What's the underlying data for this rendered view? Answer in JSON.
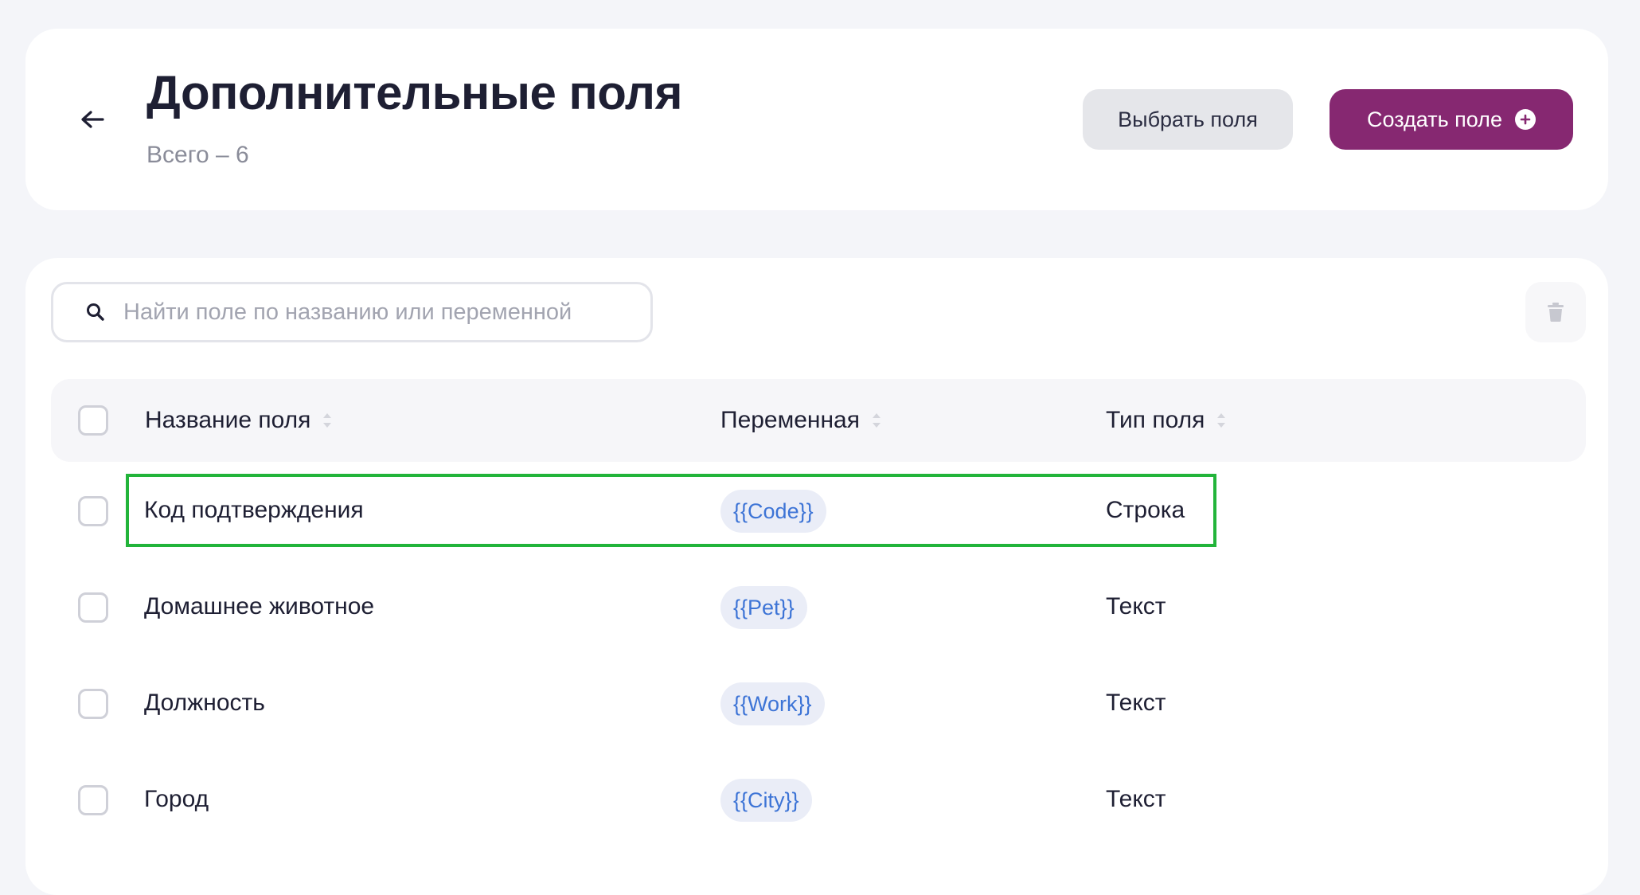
{
  "header": {
    "title": "Дополнительные поля",
    "subtitle": "Всего – 6",
    "select_fields_label": "Выбрать поля",
    "create_field_label": "Создать поле"
  },
  "search": {
    "placeholder": "Найти поле по названию или переменной",
    "value": ""
  },
  "table": {
    "columns": [
      "Название поля",
      "Переменная",
      "Тип поля"
    ],
    "rows": [
      {
        "name": "Код подтверждения",
        "variable": "{{Code}}",
        "type": "Строка",
        "checked": false,
        "highlighted": true
      },
      {
        "name": "Домашнее животное",
        "variable": "{{Pet}}",
        "type": "Текст",
        "checked": false,
        "highlighted": false
      },
      {
        "name": "Должность",
        "variable": "{{Work}}",
        "type": "Текст",
        "checked": false,
        "highlighted": false
      },
      {
        "name": "Город",
        "variable": "{{City}}",
        "type": "Текст",
        "checked": false,
        "highlighted": false
      }
    ]
  },
  "colors": {
    "accent": "#862871",
    "variable_text": "#3d74d6",
    "variable_bg": "#eaedf7",
    "highlight": "#22b43a",
    "page_bg": "#f4f5f9"
  },
  "icons": {
    "back": "arrow-left-icon",
    "create": "plus-circle-icon",
    "search": "search-icon",
    "delete": "trash-icon",
    "sort": "sort-icon"
  }
}
